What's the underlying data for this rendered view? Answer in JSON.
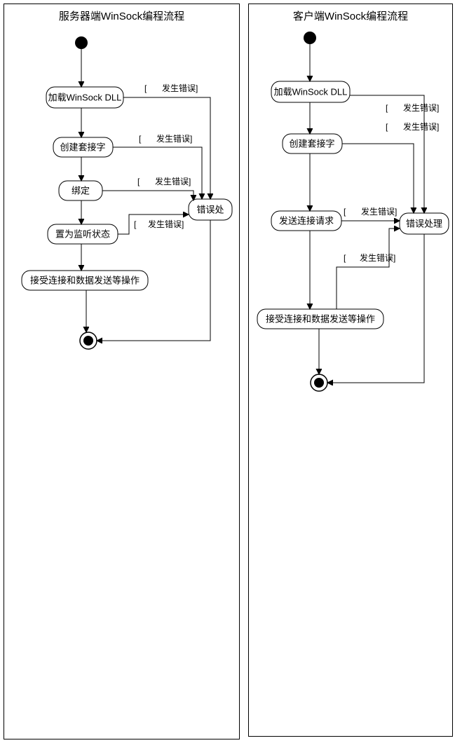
{
  "server": {
    "title": "服务器端WinSock编程流程",
    "steps": {
      "load": "加载WinSock DLL",
      "create": "创建套接字",
      "bind": "绑定",
      "listen": "置为监听状态",
      "accept": "接受连接和数据发送等操作",
      "error": "错误处"
    },
    "guard": "发生错误]"
  },
  "client": {
    "title": "客户端WinSock编程流程",
    "steps": {
      "load": "加载WinSock DLL",
      "create": "创建套接字",
      "connect": "发送连接请求",
      "accept": "接受连接和数据发送等操作",
      "error": "错误处理"
    },
    "guard": "发生错误]"
  },
  "chart_data": [
    {
      "type": "activity-diagram",
      "title": "服务器端WinSock编程流程",
      "nodes": [
        {
          "id": "start",
          "kind": "initial"
        },
        {
          "id": "load",
          "kind": "action",
          "label": "加载WinSock DLL"
        },
        {
          "id": "create",
          "kind": "action",
          "label": "创建套接字"
        },
        {
          "id": "bind",
          "kind": "action",
          "label": "绑定"
        },
        {
          "id": "listen",
          "kind": "action",
          "label": "置为监听状态"
        },
        {
          "id": "accept",
          "kind": "action",
          "label": "接受连接和数据发送等操作"
        },
        {
          "id": "error",
          "kind": "action",
          "label": "错误处"
        },
        {
          "id": "end",
          "kind": "final"
        }
      ],
      "edges": [
        {
          "from": "start",
          "to": "load"
        },
        {
          "from": "load",
          "to": "create"
        },
        {
          "from": "create",
          "to": "bind"
        },
        {
          "from": "bind",
          "to": "listen"
        },
        {
          "from": "listen",
          "to": "accept"
        },
        {
          "from": "accept",
          "to": "end"
        },
        {
          "from": "load",
          "to": "error",
          "guard": "[发生错误]"
        },
        {
          "from": "create",
          "to": "error",
          "guard": "[发生错误]"
        },
        {
          "from": "bind",
          "to": "error",
          "guard": "[发生错误]"
        },
        {
          "from": "listen",
          "to": "error",
          "guard": "[发生错误]"
        },
        {
          "from": "error",
          "to": "end"
        }
      ]
    },
    {
      "type": "activity-diagram",
      "title": "客户端WinSock编程流程",
      "nodes": [
        {
          "id": "start",
          "kind": "initial"
        },
        {
          "id": "load",
          "kind": "action",
          "label": "加载WinSock DLL"
        },
        {
          "id": "create",
          "kind": "action",
          "label": "创建套接字"
        },
        {
          "id": "connect",
          "kind": "action",
          "label": "发送连接请求"
        },
        {
          "id": "accept",
          "kind": "action",
          "label": "接受连接和数据发送等操作"
        },
        {
          "id": "error",
          "kind": "action",
          "label": "错误处理"
        },
        {
          "id": "end",
          "kind": "final"
        }
      ],
      "edges": [
        {
          "from": "start",
          "to": "load"
        },
        {
          "from": "load",
          "to": "create"
        },
        {
          "from": "create",
          "to": "connect"
        },
        {
          "from": "connect",
          "to": "accept"
        },
        {
          "from": "accept",
          "to": "end"
        },
        {
          "from": "load",
          "to": "error",
          "guard": "[发生错误]"
        },
        {
          "from": "create",
          "to": "error",
          "guard": "[发生错误]"
        },
        {
          "from": "connect",
          "to": "error",
          "guard": "[发生错误]"
        },
        {
          "from": "accept",
          "to": "error",
          "guard": "[发生错误]"
        },
        {
          "from": "error",
          "to": "end"
        }
      ]
    }
  ]
}
